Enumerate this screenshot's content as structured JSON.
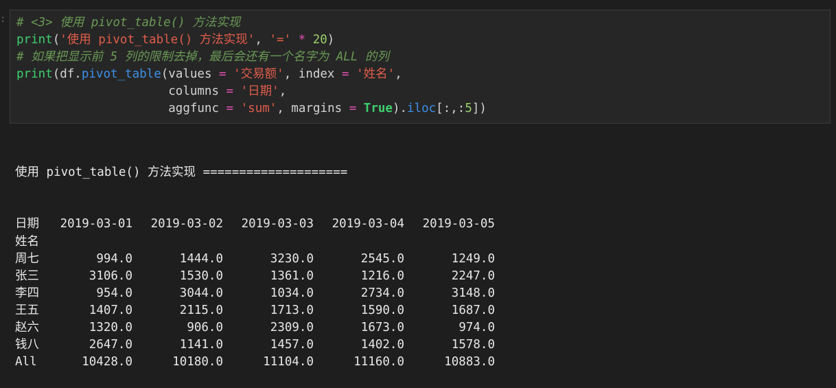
{
  "code_cell": {
    "gutter_mark": ":",
    "lines": [
      [
        {
          "c": "cm",
          "t": "# <3> 使用 pivot_table() 方法实现"
        }
      ],
      [
        {
          "c": "bi",
          "t": "print"
        },
        {
          "c": "pl",
          "t": "("
        },
        {
          "c": "st",
          "t": "'使用 pivot_table() 方法实现'"
        },
        {
          "c": "pl",
          "t": ", "
        },
        {
          "c": "st",
          "t": "'='"
        },
        {
          "c": "pl",
          "t": " "
        },
        {
          "c": "op",
          "t": "*"
        },
        {
          "c": "pl",
          "t": " "
        },
        {
          "c": "nu",
          "t": "20"
        },
        {
          "c": "pl",
          "t": ")"
        }
      ],
      [
        {
          "c": "cm",
          "t": "# 如果把显示前 5 列的限制去掉，最后会还有一个名字为 ALL 的列"
        }
      ],
      [
        {
          "c": "bi",
          "t": "print"
        },
        {
          "c": "pl",
          "t": "(df."
        },
        {
          "c": "meth",
          "t": "pivot_table"
        },
        {
          "c": "pl",
          "t": "(values "
        },
        {
          "c": "op",
          "t": "="
        },
        {
          "c": "pl",
          "t": " "
        },
        {
          "c": "st",
          "t": "'交易额'"
        },
        {
          "c": "pl",
          "t": ", index "
        },
        {
          "c": "op",
          "t": "="
        },
        {
          "c": "pl",
          "t": " "
        },
        {
          "c": "st",
          "t": "'姓名'"
        },
        {
          "c": "pl",
          "t": ","
        }
      ],
      [
        {
          "c": "pl",
          "t": "                     columns "
        },
        {
          "c": "op",
          "t": "="
        },
        {
          "c": "pl",
          "t": " "
        },
        {
          "c": "st",
          "t": "'日期'"
        },
        {
          "c": "pl",
          "t": ","
        }
      ],
      [
        {
          "c": "pl",
          "t": "                     aggfunc "
        },
        {
          "c": "op",
          "t": "="
        },
        {
          "c": "pl",
          "t": " "
        },
        {
          "c": "st",
          "t": "'sum'"
        },
        {
          "c": "pl",
          "t": ", margins "
        },
        {
          "c": "op",
          "t": "="
        },
        {
          "c": "pl",
          "t": " "
        },
        {
          "c": "kw",
          "t": "True"
        },
        {
          "c": "pl",
          "t": ")."
        },
        {
          "c": "meth",
          "t": "iloc"
        },
        {
          "c": "pl",
          "t": "[:,:"
        },
        {
          "c": "nu",
          "t": "5"
        },
        {
          "c": "pl",
          "t": "])"
        }
      ]
    ]
  },
  "output": {
    "header_line": "使用 pivot_table() 方法实现 ====================",
    "columns_label": "日期",
    "columns": [
      "2019-03-01",
      "2019-03-02",
      "2019-03-03",
      "2019-03-04",
      "2019-03-05"
    ],
    "index_label": "姓名",
    "rows": [
      {
        "name": "周七",
        "values": [
          "994.0",
          "1444.0",
          "3230.0",
          "2545.0",
          "1249.0"
        ]
      },
      {
        "name": "张三",
        "values": [
          "3106.0",
          "1530.0",
          "1361.0",
          "1216.0",
          "2247.0"
        ]
      },
      {
        "name": "李四",
        "values": [
          "954.0",
          "3044.0",
          "1034.0",
          "2734.0",
          "3148.0"
        ]
      },
      {
        "name": "王五",
        "values": [
          "1407.0",
          "2115.0",
          "1713.0",
          "1590.0",
          "1687.0"
        ]
      },
      {
        "name": "赵六",
        "values": [
          "1320.0",
          "906.0",
          "2309.0",
          "1673.0",
          "974.0"
        ]
      },
      {
        "name": "钱八",
        "values": [
          "2647.0",
          "1141.0",
          "1457.0",
          "1402.0",
          "1578.0"
        ]
      },
      {
        "name": "All",
        "values": [
          "10428.0",
          "10180.0",
          "11104.0",
          "11160.0",
          "10883.0"
        ]
      }
    ]
  }
}
